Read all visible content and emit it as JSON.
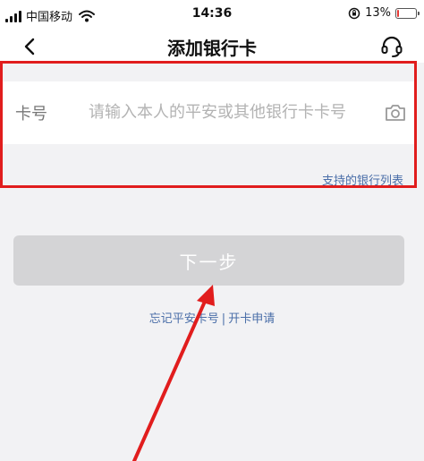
{
  "status_bar": {
    "carrier": "中国移动",
    "time": "14:36",
    "battery": "13%",
    "battery_level": 0.13
  },
  "nav": {
    "title": "添加银行卡",
    "back_icon": "chevron-left-icon",
    "support_icon": "headset-icon"
  },
  "card_form": {
    "label": "卡号",
    "value": "",
    "placeholder": "请输入本人的平安或其他银行卡卡号",
    "camera_icon": "camera-icon",
    "supported_banks_link": "支持的银行列表"
  },
  "next_button": {
    "label": "下一步"
  },
  "bottom_links": {
    "forgot": "忘记平安卡号",
    "separator": "|",
    "apply": "开卡申请"
  },
  "annotation": {
    "highlight_color": "#e11d1d",
    "arrow_color": "#e11d1d"
  }
}
